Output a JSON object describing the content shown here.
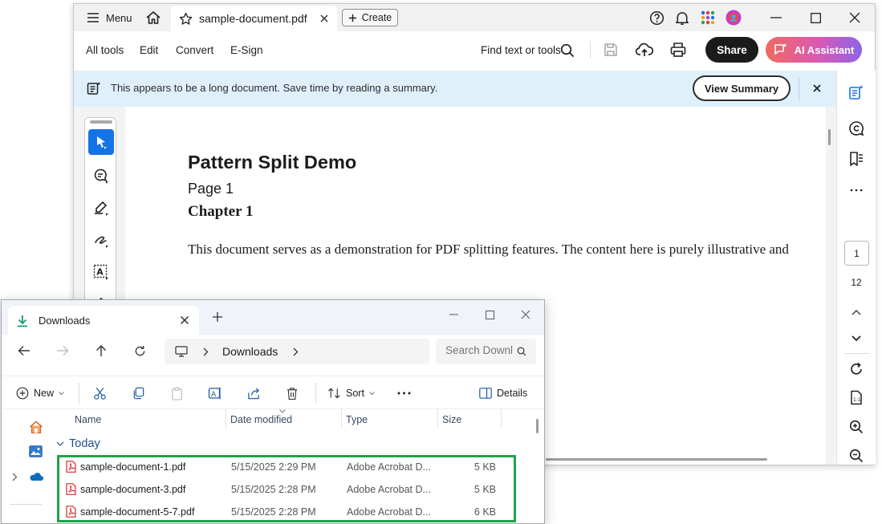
{
  "acrobat": {
    "menu_label": "Menu",
    "tab_title": "sample-document.pdf",
    "create_label": "Create",
    "toolbar": {
      "all_tools": "All tools",
      "edit": "Edit",
      "convert": "Convert",
      "esign": "E-Sign",
      "find": "Find text or tools",
      "share": "Share",
      "ai_assistant": "AI Assistant"
    },
    "banner": {
      "text": "This appears to be a long document. Save time by reading a summary.",
      "button": "View Summary"
    },
    "document": {
      "title": "Pattern Split Demo",
      "page_label": "Page 1",
      "chapter": "Chapter 1",
      "body": "This document serves as a demonstration for PDF splitting features. The content here is purely illustrative and"
    },
    "page_nav": {
      "current": "1",
      "total": "12"
    }
  },
  "explorer": {
    "tab_title": "Downloads",
    "breadcrumb": "Downloads",
    "search_placeholder": "Search Downloads",
    "commands": {
      "new": "New",
      "sort": "Sort",
      "details": "Details"
    },
    "columns": {
      "name": "Name",
      "date": "Date modified",
      "type": "Type",
      "size": "Size"
    },
    "group": "Today",
    "files": [
      {
        "name": "sample-document-1.pdf",
        "date": "5/15/2025 2:29 PM",
        "type": "Adobe Acrobat D...",
        "size": "5 KB"
      },
      {
        "name": "sample-document-3.pdf",
        "date": "5/15/2025 2:28 PM",
        "type": "Adobe Acrobat D...",
        "size": "5 KB"
      },
      {
        "name": "sample-document-5-7.pdf",
        "date": "5/15/2025 2:28 PM",
        "type": "Adobe Acrobat D...",
        "size": "6 KB"
      }
    ]
  },
  "colors": {
    "acrobat_accent": "#1473e6",
    "banner_bg": "#dff0fb",
    "highlight": "#1ea34a",
    "pdf_icon": "#d7282f"
  }
}
